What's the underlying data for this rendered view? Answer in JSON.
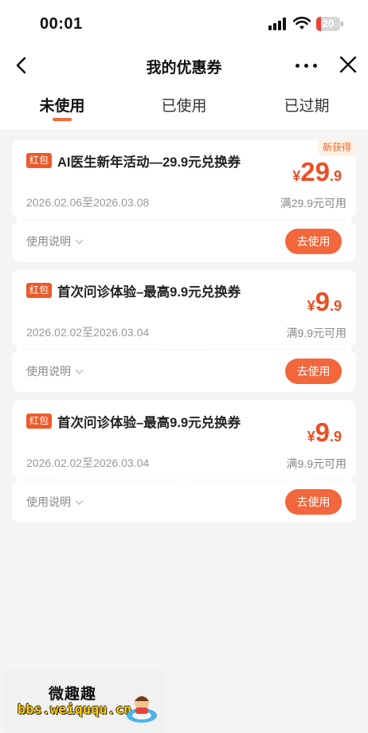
{
  "status_bar": {
    "time": "00:01",
    "battery": "20",
    "battery_level": 0.2
  },
  "nav": {
    "title": "我的优惠券"
  },
  "tabs": [
    {
      "label": "未使用",
      "active": true
    },
    {
      "label": "已使用",
      "active": false
    },
    {
      "label": "已过期",
      "active": false
    }
  ],
  "coupons": [
    {
      "tag": "红包",
      "title": "AI医生新年活动—29.9元兑换券",
      "date": "2026.02.06至2026.03.08",
      "currency": "¥",
      "price_int": "29",
      "price_dec": ".9",
      "condition": "满29.9元可用",
      "badge": "新获得",
      "instructions": "使用说明",
      "use_button": "去使用"
    },
    {
      "tag": "红包",
      "title": "首次问诊体验–最高9.9元兑换券",
      "date": "2026.02.02至2026.03.04",
      "currency": "¥",
      "price_int": "9",
      "price_dec": ".9",
      "condition": "满9.9元可用",
      "instructions": "使用说明",
      "use_button": "去使用"
    },
    {
      "tag": "红包",
      "title": "首次问诊体验–最高9.9元兑换券",
      "date": "2026.02.02至2026.03.04",
      "currency": "¥",
      "price_int": "9",
      "price_dec": ".9",
      "condition": "满9.9元可用",
      "instructions": "使用说明",
      "use_button": "去使用"
    }
  ],
  "watermark": {
    "site_cn": "微趣趣",
    "url": "bbs.weiququ.cn"
  },
  "colors": {
    "accent": "#f2673c",
    "price": "#ea4f24",
    "tag": "#ec5a2a",
    "badge_bg": "#fff0e5",
    "battery_low": "#e8433a"
  }
}
